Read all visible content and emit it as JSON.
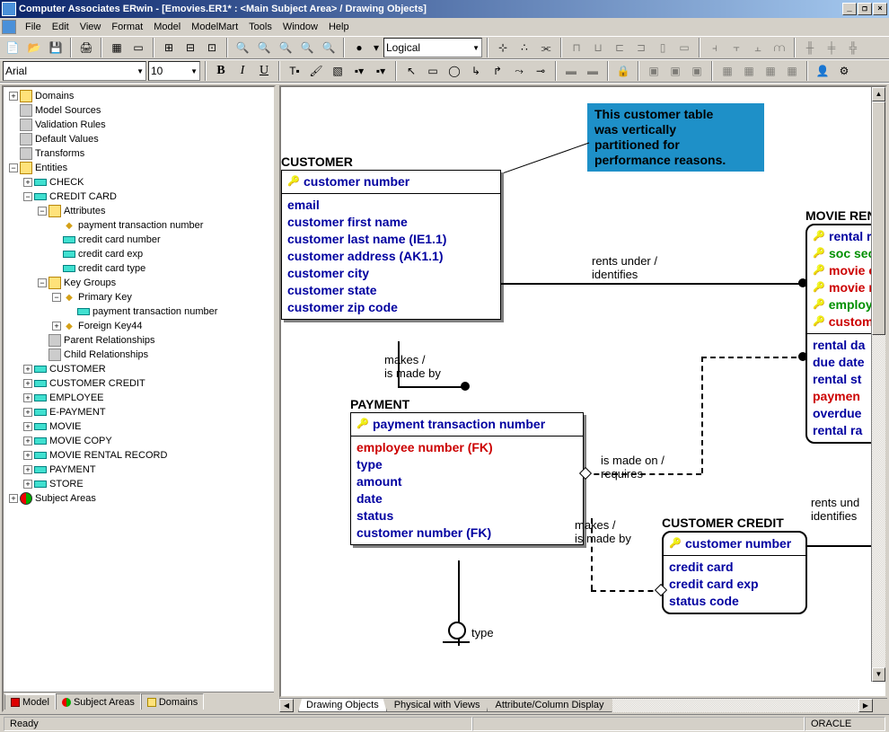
{
  "title": "Computer Associates ERwin - [Emovies.ER1* : <Main Subject Area> / Drawing Objects]",
  "menu": [
    "File",
    "Edit",
    "View",
    "Format",
    "Model",
    "ModelMart",
    "Tools",
    "Window",
    "Help"
  ],
  "toolbar1": {
    "logical_label": "Logical"
  },
  "toolbar2": {
    "font": "Arial",
    "size": "10"
  },
  "tree": {
    "items": [
      {
        "indent": 0,
        "toggle": "+",
        "icon": "folder",
        "label": "Domains"
      },
      {
        "indent": 0,
        "toggle": "",
        "icon": "gray",
        "label": "Model Sources"
      },
      {
        "indent": 0,
        "toggle": "",
        "icon": "gray",
        "label": "Validation Rules"
      },
      {
        "indent": 0,
        "toggle": "",
        "icon": "gray",
        "label": "Default Values"
      },
      {
        "indent": 0,
        "toggle": "",
        "icon": "gray",
        "label": "Transforms"
      },
      {
        "indent": 0,
        "toggle": "−",
        "icon": "folder",
        "label": "Entities"
      },
      {
        "indent": 1,
        "toggle": "+",
        "icon": "cyan",
        "label": "CHECK"
      },
      {
        "indent": 1,
        "toggle": "−",
        "icon": "cyan",
        "label": "CREDIT CARD"
      },
      {
        "indent": 2,
        "toggle": "−",
        "icon": "folder",
        "label": "Attributes"
      },
      {
        "indent": 3,
        "toggle": "",
        "icon": "yellow",
        "label": "payment transaction number"
      },
      {
        "indent": 3,
        "toggle": "",
        "icon": "cyan",
        "label": "credit card number"
      },
      {
        "indent": 3,
        "toggle": "",
        "icon": "cyan",
        "label": "credit card exp"
      },
      {
        "indent": 3,
        "toggle": "",
        "icon": "cyan",
        "label": "credit card type"
      },
      {
        "indent": 2,
        "toggle": "−",
        "icon": "folder",
        "label": "Key Groups"
      },
      {
        "indent": 3,
        "toggle": "−",
        "icon": "yellow",
        "label": "Primary Key"
      },
      {
        "indent": 4,
        "toggle": "",
        "icon": "cyan",
        "label": "payment transaction number"
      },
      {
        "indent": 3,
        "toggle": "+",
        "icon": "yellow",
        "label": "Foreign Key44"
      },
      {
        "indent": 2,
        "toggle": "",
        "icon": "gray",
        "label": "Parent Relationships"
      },
      {
        "indent": 2,
        "toggle": "",
        "icon": "gray",
        "label": "Child Relationships"
      },
      {
        "indent": 1,
        "toggle": "+",
        "icon": "cyan",
        "label": "CUSTOMER"
      },
      {
        "indent": 1,
        "toggle": "+",
        "icon": "cyan",
        "label": "CUSTOMER CREDIT"
      },
      {
        "indent": 1,
        "toggle": "+",
        "icon": "cyan",
        "label": "EMPLOYEE"
      },
      {
        "indent": 1,
        "toggle": "+",
        "icon": "cyan",
        "label": "E-PAYMENT"
      },
      {
        "indent": 1,
        "toggle": "+",
        "icon": "cyan",
        "label": "MOVIE"
      },
      {
        "indent": 1,
        "toggle": "+",
        "icon": "cyan",
        "label": "MOVIE COPY"
      },
      {
        "indent": 1,
        "toggle": "+",
        "icon": "cyan",
        "label": "MOVIE RENTAL RECORD"
      },
      {
        "indent": 1,
        "toggle": "+",
        "icon": "cyan",
        "label": "PAYMENT"
      },
      {
        "indent": 1,
        "toggle": "+",
        "icon": "cyan",
        "label": "STORE"
      },
      {
        "indent": 0,
        "toggle": "+",
        "icon": "redgreen",
        "label": "Subject Areas"
      }
    ],
    "tabs": [
      "Model",
      "Subject Areas",
      "Domains"
    ]
  },
  "canvas": {
    "note": "This customer table\nwas vertically\npartitioned for\nperformance reasons.",
    "customer": {
      "name": "CUSTOMER",
      "pk": [
        "customer number"
      ],
      "attrs": [
        {
          "t": "email",
          "c": "blue"
        },
        {
          "t": "customer first name",
          "c": "blue"
        },
        {
          "t": "customer last name (IE1.1)",
          "c": "blue"
        },
        {
          "t": "customer address (AK1.1)",
          "c": "blue"
        },
        {
          "t": "customer city",
          "c": "blue"
        },
        {
          "t": "customer state",
          "c": "blue"
        },
        {
          "t": "customer zip code",
          "c": "blue"
        }
      ]
    },
    "payment": {
      "name": "PAYMENT",
      "pk": [
        "payment transaction number"
      ],
      "attrs": [
        {
          "t": "employee number (FK)",
          "c": "red"
        },
        {
          "t": "type",
          "c": "blue"
        },
        {
          "t": "amount",
          "c": "blue"
        },
        {
          "t": "date",
          "c": "blue"
        },
        {
          "t": "status",
          "c": "blue"
        },
        {
          "t": "customer number (FK)",
          "c": "blue"
        }
      ]
    },
    "movierent": {
      "name": "MOVIE RENT",
      "pk": [
        {
          "t": "rental re",
          "c": "blue"
        },
        {
          "t": "soc sec",
          "c": "green"
        },
        {
          "t": "movie c",
          "c": "red"
        },
        {
          "t": "movie n",
          "c": "red"
        },
        {
          "t": "employe",
          "c": "green"
        },
        {
          "t": "custome",
          "c": "red"
        }
      ],
      "attrs": [
        {
          "t": "rental da",
          "c": "blue"
        },
        {
          "t": "due date",
          "c": "blue"
        },
        {
          "t": "rental st",
          "c": "blue"
        },
        {
          "t": "paymen",
          "c": "red"
        },
        {
          "t": "overdue",
          "c": "blue"
        },
        {
          "t": "rental ra",
          "c": "blue"
        }
      ]
    },
    "custcredit": {
      "name": "CUSTOMER CREDIT",
      "pk": [
        "customer number"
      ],
      "attrs": [
        {
          "t": "credit card",
          "c": "blue"
        },
        {
          "t": "credit card exp",
          "c": "blue"
        },
        {
          "t": "status code",
          "c": "blue"
        }
      ]
    },
    "rels": {
      "r1": "makes /\nis made by",
      "r2": "rents under /\nidentifies",
      "r3": "is made on /\nrequires",
      "r4": "makes /\nis made by",
      "r5": "rents und\nidentifies",
      "r6": "type"
    },
    "tabs": [
      "Drawing Objects",
      "Physical with Views",
      "Attribute/Column Display"
    ]
  },
  "status": {
    "ready": "Ready",
    "db": "ORACLE"
  }
}
